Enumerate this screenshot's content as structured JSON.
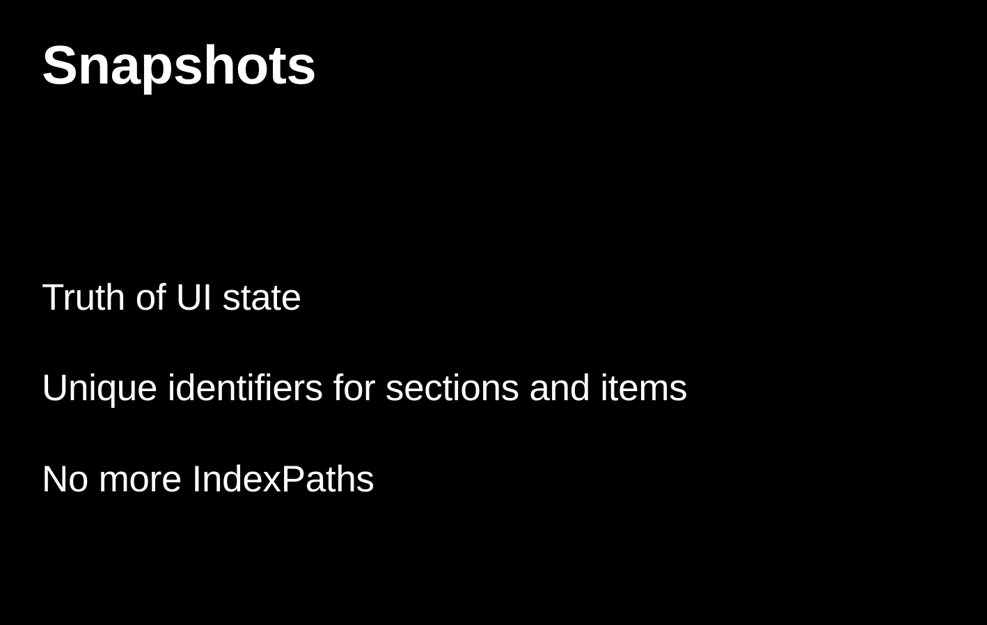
{
  "slide": {
    "title": "Snapshots",
    "bullets": [
      "Truth of UI state",
      "Unique identifiers for sections and items",
      "No more IndexPaths"
    ]
  }
}
